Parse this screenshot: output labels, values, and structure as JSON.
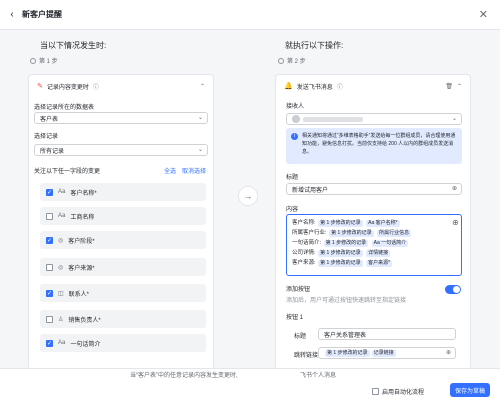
{
  "header": {
    "title": "新客户提醒"
  },
  "left": {
    "title": "当以下情况发生时:",
    "step": "第 1 步",
    "trigger": {
      "name": "记录内容变更时",
      "table_label": "选择记录所在的数据表",
      "table_value": "客户表",
      "record_label": "选择记录",
      "record_value": "所有记录",
      "fields_label": "关注以下任一字段的变更",
      "select_all": "全选",
      "cancel_select": "取消选择",
      "fields": [
        {
          "label": "客户名称*",
          "checked": true,
          "icon": "Aa"
        },
        {
          "label": "工商名称",
          "checked": false,
          "icon": "Aa"
        },
        {
          "label": "客户阶段*",
          "checked": true,
          "icon": "◎"
        },
        {
          "label": "客户来源*",
          "checked": false,
          "icon": "◎"
        },
        {
          "label": "联系人*",
          "checked": true,
          "icon": "◫"
        },
        {
          "label": "销售负责人*",
          "checked": false,
          "icon": "♙"
        },
        {
          "label": "一句话简介",
          "checked": true,
          "icon": "Aa"
        }
      ]
    }
  },
  "right": {
    "title": "就执行以下操作:",
    "step": "第 2 步",
    "action": {
      "name": "发送飞书消息",
      "receiver_label": "接收人",
      "notice": "相关通知将通过“多维表格助手”发送给每一位群组成员，请合理使用通知功能，避免信息打扰。当前仅支持给 200 人以内的群组成员发送消息。",
      "title_label": "标题",
      "title_value": "新增试用客户",
      "content_label": "内容",
      "content_lines": [
        {
          "prefix": "客户名称:",
          "tag1": "第 1 步修改的记录",
          "tag2": "Aa 客户名称*"
        },
        {
          "prefix": "所属客户行业:",
          "tag1": "第 1 步修改的记录",
          "tag2": "所属行业信息"
        },
        {
          "prefix": "一句话简介:",
          "tag1": "第 1 步修改的记录",
          "tag2": "Aa 一句话简介"
        },
        {
          "prefix": "公司详情:",
          "tag1": "第 1 步修改的记录",
          "tag2": "详情链接"
        },
        {
          "prefix": "客户来源:",
          "tag1": "第 1 步修改的记录",
          "tag2": "客户来源*"
        }
      ],
      "button_toggle_label": "添加按钮",
      "button_toggle_desc": "添加后，用户可通过按钮快速跳转至指定链接",
      "button1_label": "按钮 1",
      "button1_title_label": "标题",
      "button1_title_value": "客户关系管理表",
      "button1_link_label": "跳转链接",
      "button1_link_tag1": "第 1 步修改的记录",
      "button1_link_tag2": "记录链接"
    }
  },
  "footer": {
    "summary_left": "当“客户表”中的任意记录内容发生变更时,",
    "summary_right": "飞书个人消息",
    "enable_label": "启用自动化流程",
    "save_label": "保存为草稿"
  }
}
